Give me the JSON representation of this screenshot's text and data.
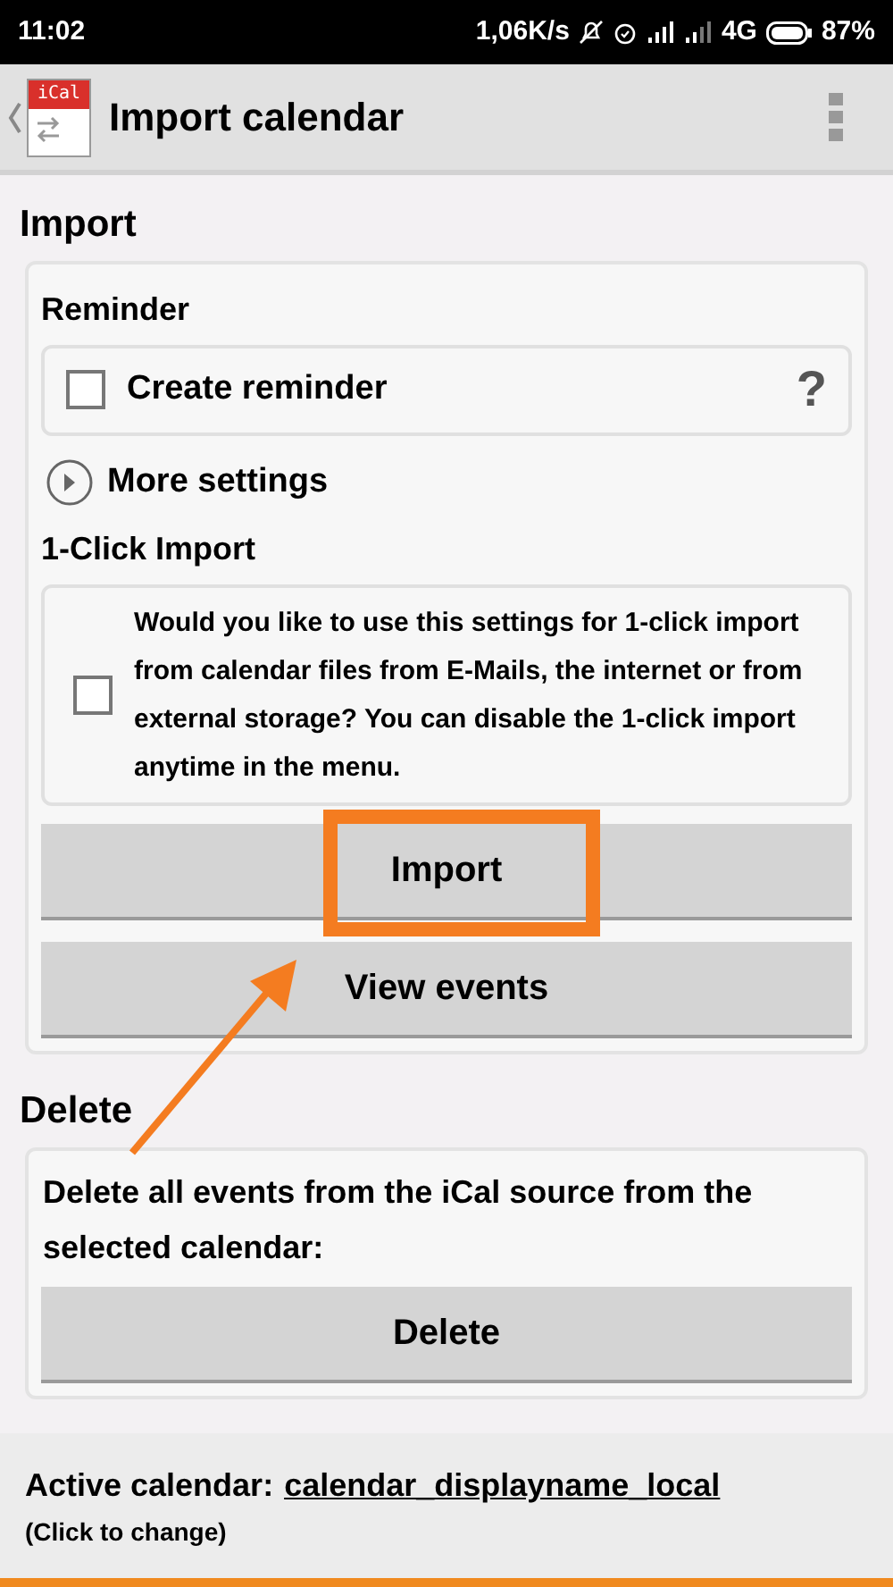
{
  "status_bar": {
    "time": "11:02",
    "net_speed": "1,06K/s",
    "network": "4G",
    "battery": "87%"
  },
  "app_bar": {
    "title": "Import calendar",
    "logo_text": "iCal"
  },
  "import_section": {
    "heading": "Import",
    "reminder_label": "Reminder",
    "reminder": {
      "label": "Create reminder",
      "checked": false,
      "help": "?"
    },
    "more_settings": {
      "label": "More settings",
      "expanded": false
    },
    "one_click_label": "1-Click Import",
    "one_click": {
      "text": "Would you like to use this settings for 1-click import from calendar files from E-Mails, the internet or from external storage? You can disable the 1-click import anytime in the menu.",
      "checked": false
    },
    "buttons": [
      "Import",
      "View events"
    ]
  },
  "delete_section": {
    "heading": "Delete",
    "text": "Delete all events from the iCal source from the selected calendar:",
    "button": "Delete"
  },
  "footer": {
    "label": "Active calendar:",
    "calendar": "calendar_displayname_local",
    "hint": "(Click to change)"
  },
  "annotations": {
    "highlight_frame": true,
    "arrow": true
  }
}
